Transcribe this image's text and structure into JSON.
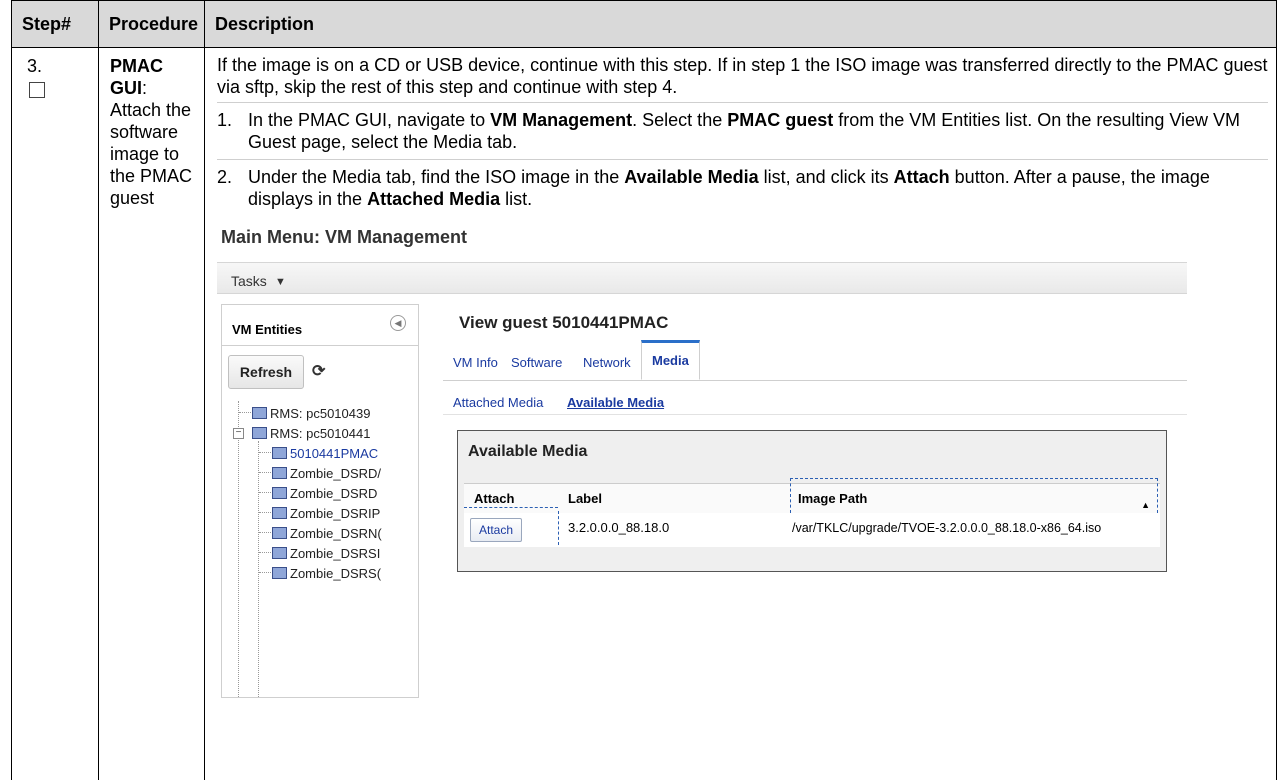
{
  "header": {
    "col1": "Step#",
    "col2": "Procedure",
    "col3": "Description"
  },
  "step": {
    "number": "3.",
    "procedure_title": "PMAC GUI",
    "procedure_rest": "Attach the software image to the PMAC guest",
    "intro": "If the image is on a CD or USB device, continue with this step.  If in step 1 the ISO image was transferred directly to the PMAC guest via sftp, skip the rest of this step and continue with step 4.",
    "item1": {
      "num": "1.",
      "t1": "In the PMAC GUI, navigate to ",
      "b1": "VM Management",
      "t2": ".  Select the ",
      "b2": "PMAC guest",
      "t3": " from the VM Entities list.  On the resulting View VM Guest page, select the Media tab."
    },
    "item2": {
      "num": "2.",
      "t1": "Under the Media tab, find the ISO image in the ",
      "b1": "Available Media",
      "t2": " list, and click its ",
      "b2": "Attach",
      "t3": " button.  After a pause, the image displays in the ",
      "b3": "Attached Media",
      "t4": " list."
    }
  },
  "screenshot": {
    "heading": "Main Menu: VM Management",
    "tasks_label": "Tasks",
    "vm_entities_title": "VM Entities",
    "refresh_label": "Refresh",
    "tree": [
      "RMS: pc5010439",
      "RMS: pc5010441",
      "5010441PMAC",
      "Zombie_DSRD/",
      "Zombie_DSRD",
      "Zombie_DSRIP",
      "Zombie_DSRN(",
      "Zombie_DSRSI",
      "Zombie_DSRS("
    ],
    "guest_title": "View guest 5010441PMAC",
    "tabs": [
      "VM Info",
      "Software",
      "Network",
      "Media"
    ],
    "subtabs": [
      "Attached Media",
      "Available Media"
    ],
    "available_media_title": "Available Media",
    "columns": [
      "Attach",
      "Label",
      "Image Path"
    ],
    "row": {
      "attach_button": "Attach",
      "label": "3.2.0.0.0_88.18.0",
      "image_path": "/var/TKLC/upgrade/TVOE-3.2.0.0.0_88.18.0-x86_64.iso"
    }
  }
}
